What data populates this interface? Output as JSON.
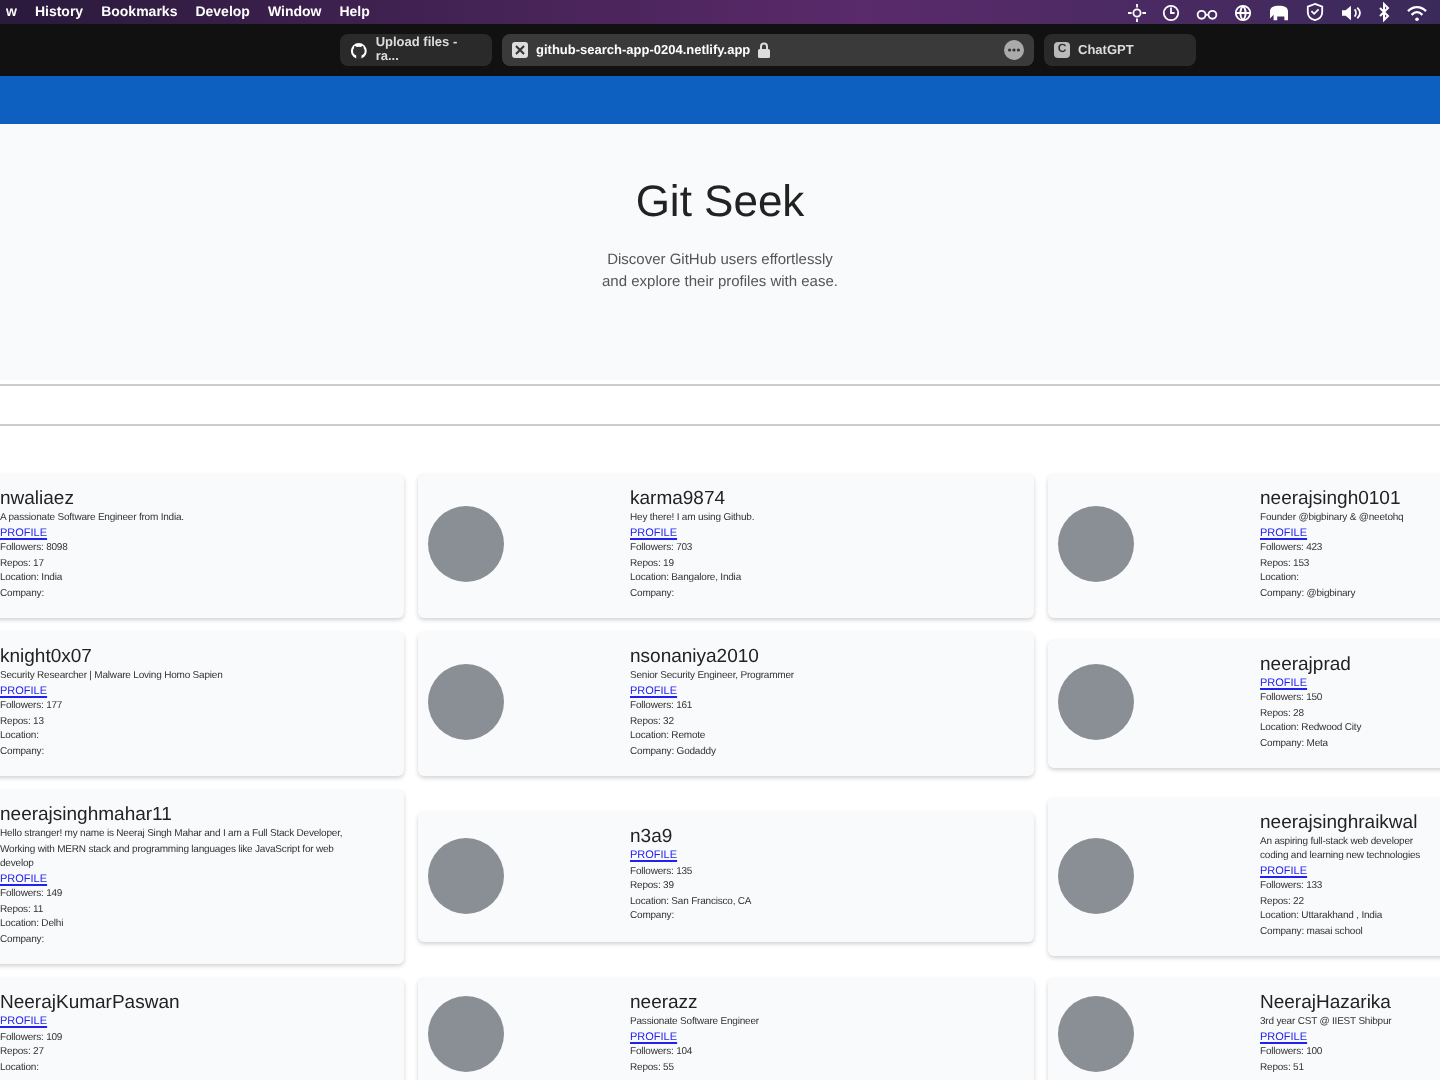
{
  "menu_bar": {
    "items": [
      "w",
      "History",
      "Bookmarks",
      "Develop",
      "Window",
      "Help"
    ]
  },
  "browser_tabs": [
    {
      "title": "Upload files - ra...",
      "kind": "github",
      "selected": false
    },
    {
      "title": "github-search-app-0204.netlify.app",
      "kind": "address",
      "selected": true
    },
    {
      "title": "ChatGPT",
      "kind": "letter",
      "badge": "C",
      "selected": false
    }
  ],
  "header": {
    "title": "Git Seek",
    "subtitle": [
      "Discover GitHub users effortlessly",
      "and explore their profiles with ease."
    ]
  },
  "users": [
    {
      "name": "nwaliaez",
      "photo": false,
      "bio": [
        "A passionate Software Engineer from India."
      ],
      "link": "PROFILE",
      "stats": [
        "Followers: 8098",
        "Repos: 17",
        "Location: India",
        "Company:"
      ]
    },
    {
      "name": "karma9874",
      "photo": true,
      "bio": [
        "Hey there! I am using Github."
      ],
      "link": "PROFILE",
      "stats": [
        "Followers: 703",
        "Repos: 19",
        "Location: Bangalore, India",
        "Company:"
      ]
    },
    {
      "name": "neerajsingh0101",
      "photo": true,
      "bio": [
        "Founder @bigbinary & @neetohq"
      ],
      "link": "PROFILE",
      "stats": [
        "Followers: 423",
        "Repos: 153",
        "Location:",
        "Company: @bigbinary"
      ]
    },
    {
      "name": "knight0x07",
      "photo": false,
      "bio": [
        "Security Researcher | Malware Loving Homo Sapien"
      ],
      "link": "PROFILE",
      "stats": [
        "Followers: 177",
        "Repos: 13",
        "Location:",
        "Company:"
      ]
    },
    {
      "name": "nsonaniya2010",
      "photo": true,
      "bio": [
        "Senior Security Engineer, Programmer"
      ],
      "link": "PROFILE",
      "stats": [
        "Followers: 161",
        "Repos: 32",
        "Location: Remote",
        "Company: Godaddy"
      ]
    },
    {
      "name": "neerajprad",
      "photo": true,
      "link": "PROFILE",
      "stats": [
        "Followers: 150",
        "Repos: 28",
        "Location: Redwood City",
        "Company: Meta"
      ]
    },
    {
      "name": "neerajsinghmahar11",
      "photo": false,
      "bio": [
        "Hello stranger! my name is Neeraj Singh Mahar and I am a Full Stack Developer,",
        "Working with MERN stack and programming languages like JavaScript for web",
        "develop"
      ],
      "link": "PROFILE",
      "stats": [
        "Followers: 149",
        "Repos: 11",
        "Location: Delhi",
        "Company:"
      ]
    },
    {
      "name": "n3a9",
      "photo": true,
      "link": "PROFILE",
      "stats": [
        "Followers: 135",
        "Repos: 39",
        "Location: San Francisco, CA",
        "Company:"
      ]
    },
    {
      "name": "neerajsinghraikwal",
      "photo": true,
      "bio": [
        "An aspiring full-stack web developer",
        "coding and learning new technologies"
      ],
      "link": "PROFILE",
      "stats": [
        "Followers: 133",
        "Repos: 22",
        "Location: Uttarakhand , India",
        "Company: masai school"
      ]
    },
    {
      "name": "NeerajKumarPaswan",
      "photo": false,
      "link": "PROFILE",
      "stats": [
        "Followers: 109",
        "Repos: 27",
        "Location:"
      ]
    },
    {
      "name": "neerazz",
      "photo": true,
      "bio": [
        "Passionate Software Engineer"
      ],
      "link": "PROFILE",
      "stats": [
        "Followers: 104",
        "Repos: 55"
      ]
    },
    {
      "name": "NeerajHazarika",
      "photo": true,
      "bio": [
        "3rd year CST @ IIEST Shibpur"
      ],
      "link": "PROFILE",
      "stats": [
        "Followers: 100",
        "Repos: 51"
      ]
    }
  ]
}
